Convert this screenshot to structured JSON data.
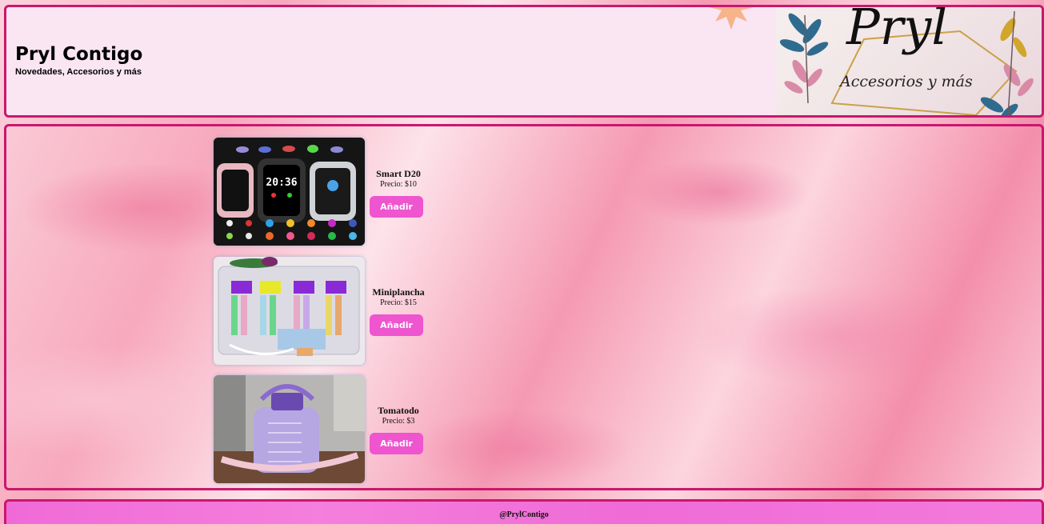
{
  "header": {
    "title": "Pryl Contigo",
    "subtitle": "Novedades, Accesorios y más",
    "logo": {
      "main_text": "Pryl",
      "sub_text": "Accesorios y más"
    }
  },
  "products": [
    {
      "name": "Smart D20",
      "price": "Precio: $10",
      "button_label": "Añadir",
      "image": "smartwatch-image",
      "watch_time": "20:36"
    },
    {
      "name": "Miniplancha",
      "price": "Precio: $15",
      "button_label": "Añadir",
      "image": "mini-hair-straightener-image"
    },
    {
      "name": "Tomatodo",
      "price": "Precio: $3",
      "button_label": "Añadir",
      "image": "water-bottle-image"
    }
  ],
  "footer": {
    "handle": "@PrylContigo"
  },
  "colors": {
    "border": "#c9176f",
    "header_bg": "#fae6f3",
    "button_bg": "#ee55cf",
    "footer_bg": "#f06ad7"
  }
}
